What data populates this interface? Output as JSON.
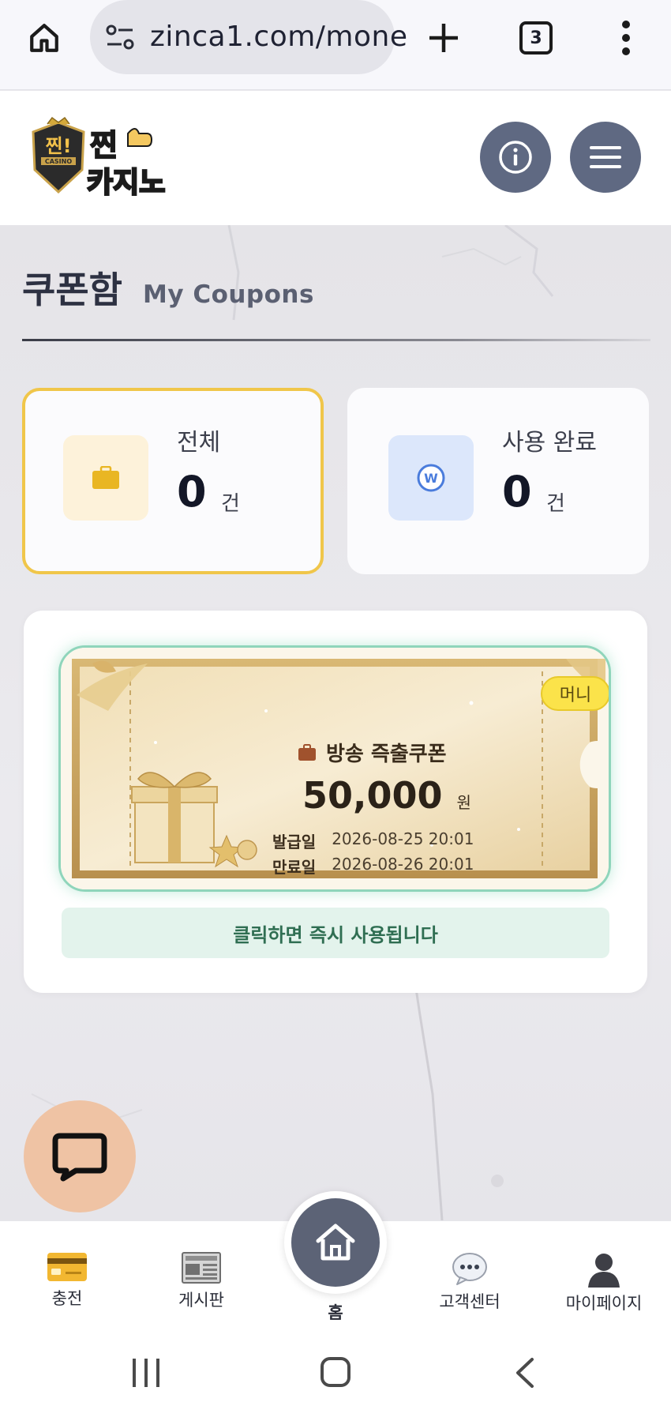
{
  "browser": {
    "url": "zinca1.com/mone",
    "tab_count": "3"
  },
  "header": {
    "logo_text": "찐! 카지노"
  },
  "page": {
    "title_ko": "쿠폰함",
    "title_en": "My Coupons"
  },
  "stats": {
    "total": {
      "label": "전체",
      "value": "0",
      "unit": "건"
    },
    "used": {
      "label": "사용 완료",
      "value": "0",
      "unit": "건"
    }
  },
  "coupon": {
    "badge": "머니",
    "name": "방송 즉출쿠폰",
    "amount": "50,000",
    "currency": "원",
    "issued_label": "발급일",
    "issued_value": "2026-08-25 20:01",
    "expires_label": "만료일",
    "expires_value": "2026-08-26 20:01",
    "use_hint": "클릭하면 즉시 사용됩니다"
  },
  "bottom_nav": {
    "items": [
      {
        "label": "충전",
        "icon": "credit-card-icon"
      },
      {
        "label": "게시판",
        "icon": "newspaper-icon"
      },
      {
        "label": "홈",
        "icon": "home-icon"
      },
      {
        "label": "고객센터",
        "icon": "speech-bubble-icon"
      },
      {
        "label": "마이페이지",
        "icon": "person-icon"
      }
    ]
  },
  "colors": {
    "accent_gold": "#f0c64a",
    "header_button": "#5f6982",
    "coupon_border": "#8fd5bb",
    "chat_fab": "#efc3a4"
  }
}
